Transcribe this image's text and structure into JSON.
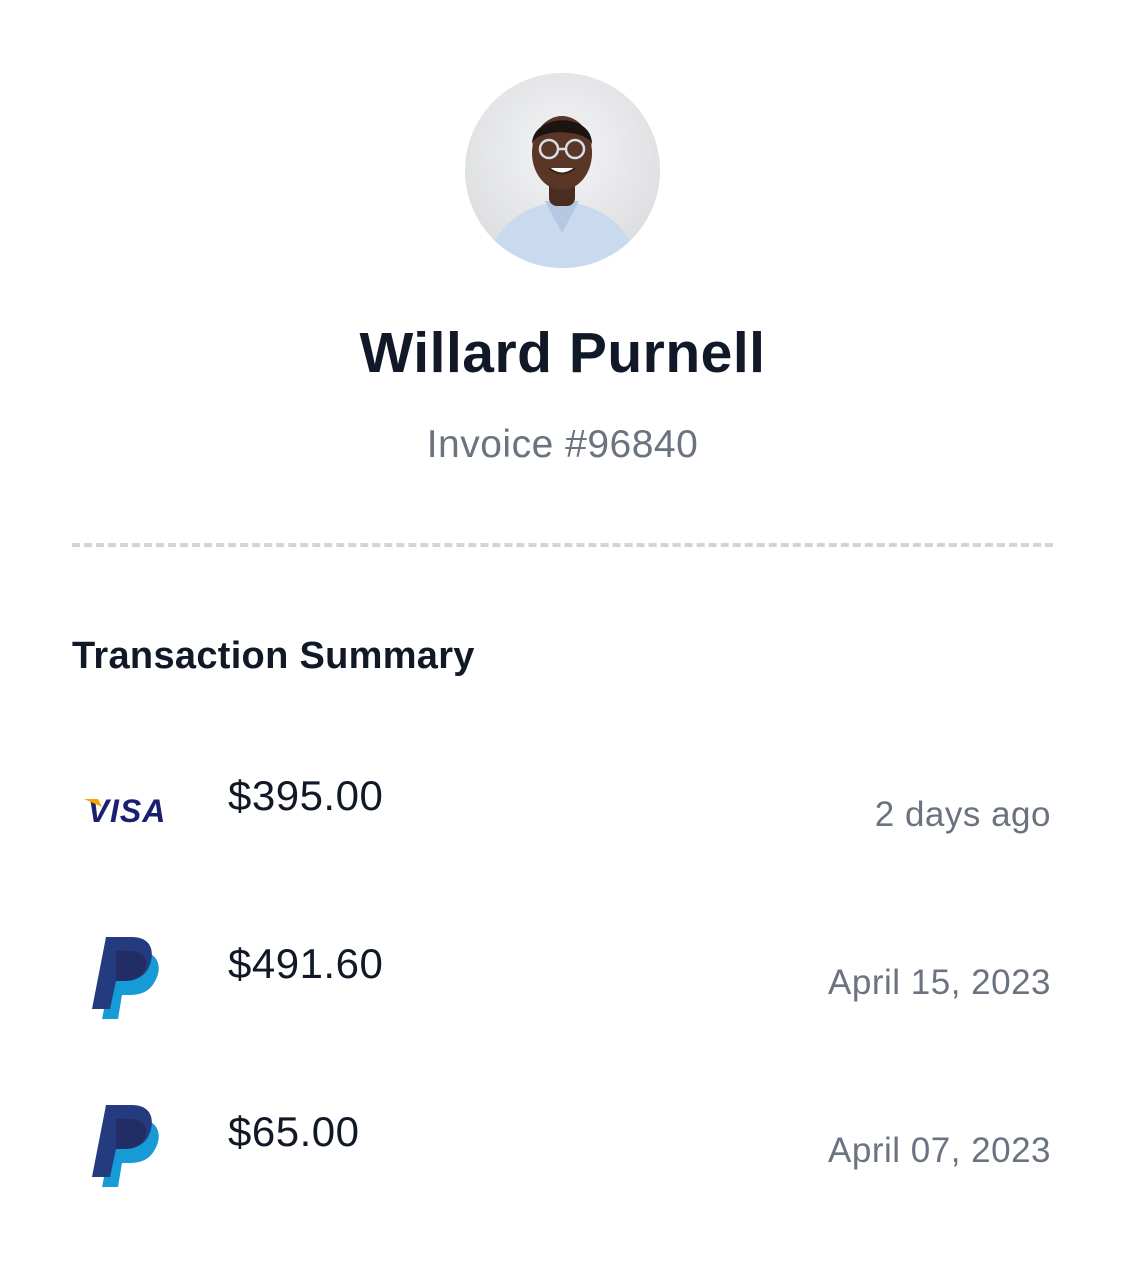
{
  "profile": {
    "name": "Willard Purnell",
    "invoice": "Invoice #96840",
    "avatar_icon": "user-avatar-photo"
  },
  "summary": {
    "title": "Transaction Summary"
  },
  "transactions": [
    {
      "method": "visa",
      "icon": "visa-icon",
      "amount": "$395.00",
      "date": "2 days ago"
    },
    {
      "method": "paypal",
      "icon": "paypal-icon",
      "amount": "$491.60",
      "date": "April 15, 2023"
    },
    {
      "method": "paypal",
      "icon": "paypal-icon",
      "amount": "$65.00",
      "date": "April 07, 2023"
    }
  ],
  "colors": {
    "text_primary": "#111827",
    "text_secondary": "#6b7280",
    "divider": "#d1d5db",
    "visa_blue": "#1a1f71",
    "visa_gold": "#f7a600",
    "paypal_dark": "#253b80",
    "paypal_light": "#179bd7"
  }
}
